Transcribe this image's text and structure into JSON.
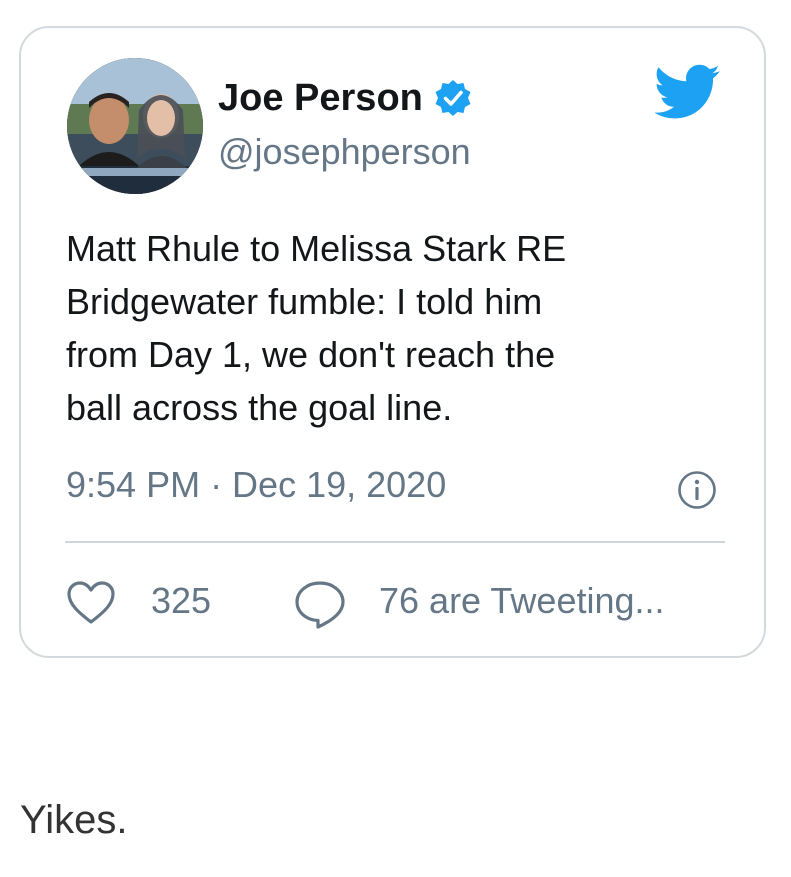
{
  "tweet": {
    "display_name": "Joe Person",
    "handle": "@josephperson",
    "text": "Matt Rhule to Melissa Stark RE\nBridgewater fumble: I told him\nfrom Day 1, we don't reach the\nball across the goal line.",
    "timestamp": "9:54 PM · Dec 19, 2020",
    "like_count": "325",
    "reply_text": "76 are Tweeting...",
    "verified": true
  },
  "icons": {
    "verified": "verified-badge-icon",
    "brand": "twitter-bird-icon",
    "info": "info-icon",
    "like": "heart-icon",
    "reply": "speech-bubble-icon"
  },
  "caption": "Yikes.",
  "colors": {
    "brand_blue": "#1da1f2",
    "secondary_text": "#657786",
    "primary_text": "#14171a",
    "border": "#d4d9dd"
  }
}
